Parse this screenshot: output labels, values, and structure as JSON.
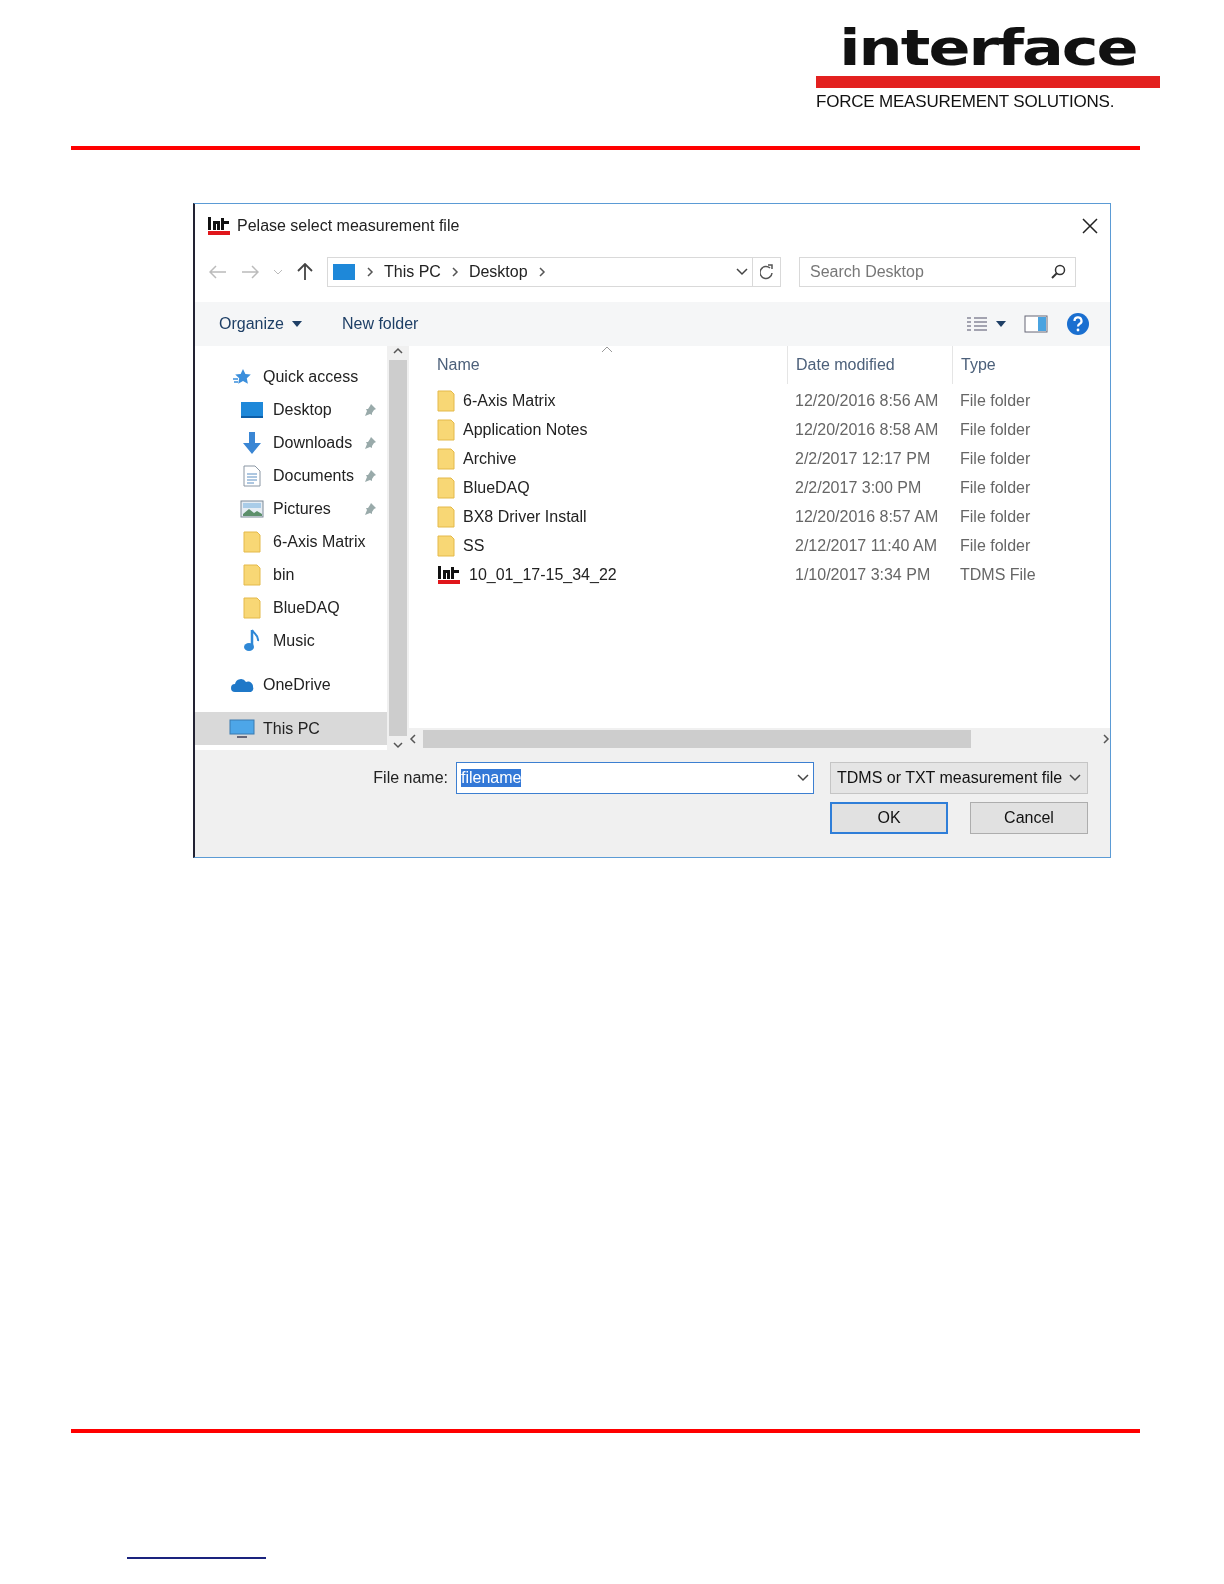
{
  "header": {
    "logo_word": "interface",
    "tagline": "FORCE MEASUREMENT SOLUTIONS."
  },
  "dialog": {
    "title": "Pelase select measurement file",
    "address": {
      "crumbs": [
        "This PC",
        "Desktop"
      ]
    },
    "search": {
      "placeholder": "Search Desktop"
    },
    "toolbar": {
      "organize": "Organize",
      "new_folder": "New folder"
    },
    "nav": [
      {
        "label": "Quick access",
        "kind": "star",
        "selected": false,
        "children": [
          {
            "label": "Desktop",
            "kind": "desktop",
            "pinned": true
          },
          {
            "label": "Downloads",
            "kind": "download",
            "pinned": true
          },
          {
            "label": "Documents",
            "kind": "document",
            "pinned": true
          },
          {
            "label": "Pictures",
            "kind": "picture",
            "pinned": true
          },
          {
            "label": "6-Axis Matrix",
            "kind": "folder",
            "pinned": false
          },
          {
            "label": "bin",
            "kind": "folder",
            "pinned": false
          },
          {
            "label": "BlueDAQ",
            "kind": "folder",
            "pinned": false
          },
          {
            "label": "Music",
            "kind": "music",
            "pinned": false
          }
        ]
      },
      {
        "label": "OneDrive",
        "kind": "cloud",
        "selected": false
      },
      {
        "label": "This PC",
        "kind": "pc",
        "selected": true
      }
    ],
    "columns": [
      "Name",
      "Date modified",
      "Type"
    ],
    "files": [
      {
        "name": "6-Axis Matrix",
        "date": "12/20/2016 8:56 AM",
        "type": "File folder",
        "kind": "folder"
      },
      {
        "name": "Application Notes",
        "date": "12/20/2016 8:58 AM",
        "type": "File folder",
        "kind": "folder"
      },
      {
        "name": "Archive",
        "date": "2/2/2017 12:17 PM",
        "type": "File folder",
        "kind": "folder"
      },
      {
        "name": "BlueDAQ",
        "date": "2/2/2017 3:00 PM",
        "type": "File folder",
        "kind": "folder"
      },
      {
        "name": "BX8 Driver Install",
        "date": "12/20/2016 8:57 AM",
        "type": "File folder",
        "kind": "folder"
      },
      {
        "name": "SS",
        "date": "2/12/2017 11:40 AM",
        "type": "File folder",
        "kind": "folder"
      },
      {
        "name": "10_01_17-15_34_22",
        "date": "1/10/2017 3:34 PM",
        "type": "TDMS File",
        "kind": "tdms"
      }
    ],
    "file_name": {
      "label": "File name:",
      "value": "filename"
    },
    "file_type": "TDMS or TXT measurement file",
    "buttons": [
      {
        "label": "OK",
        "kind": "default"
      },
      {
        "label": "Cancel",
        "kind": "normal"
      }
    ]
  }
}
